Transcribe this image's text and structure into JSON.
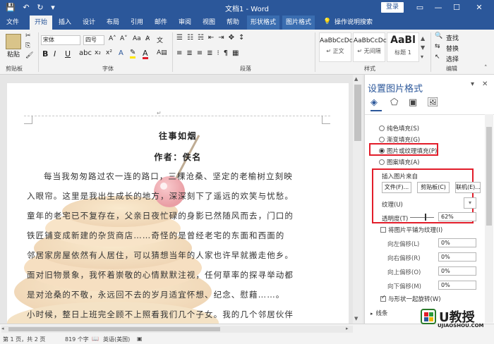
{
  "titlebar": {
    "title": "文档1 - Word",
    "login": "登录",
    "qa_save": "💾",
    "qa_undo": "↶",
    "qa_redo": "↻",
    "qa_more": "▾",
    "restore": "▭",
    "minimize": "—",
    "maximize": "☐",
    "close": "✕"
  },
  "tabs": [
    "文件",
    "开始",
    "插入",
    "设计",
    "布局",
    "引用",
    "邮件",
    "审阅",
    "视图",
    "帮助",
    "形状格式",
    "图片格式",
    "操作说明搜索"
  ],
  "ribbon": {
    "paste": "粘贴",
    "clipboard": "剪贴板",
    "font_name": "宋体",
    "font_size": "四号",
    "font_group": "字体",
    "para_group": "段落",
    "styles_group": "样式",
    "edit_group": "编辑",
    "bold": "B",
    "italic": "I",
    "underline": "U",
    "font_color": "A",
    "styles": [
      {
        "sample": "AaBbCcDc",
        "name": "↵ 正文"
      },
      {
        "sample": "AaBbCcDc",
        "name": "↵ 无间隔"
      },
      {
        "sample": "AaBl",
        "name": "标题 1"
      }
    ],
    "find": "查找",
    "replace": "替换",
    "select": "选择"
  },
  "document": {
    "title": "往事如烟",
    "author": "作者：佚名",
    "paragraphs": [
      "每当我匆匆路过农一连的路口，三棵沧桑、坚定的老榆树立刻映",
      "入眼帘。这里是我出生成长的地方，深深刻下了遥远的欢笑与忧愁。",
      "童年的老宅已不复存在，父亲日夜忙碌的身影已然随风而去，门口的",
      "铁匠铺变成新建的杂货商店……奇怪的是曾经老宅的东面和西面的",
      "邻居家房屋依然有人居住，可以猜想当年的人家也许早就搬走他乡。",
      "面对旧物景象，我怀着崇敬的心情默默注视，任何草率的探寻举动都",
      "是对沧桑的不敬，永远回不去的岁月适宜怀想、纪念、慰藉……。",
      "小时候，整日上班完全顾不上照看我们几个子女。我的几个邻居伙伴"
    ]
  },
  "pane": {
    "title": "设置图片格式",
    "fill_options": [
      {
        "label": "纯色填充(S)",
        "on": false
      },
      {
        "label": "渐变填充(G)",
        "on": false
      },
      {
        "label": "图片或纹理填充(P)",
        "on": true
      },
      {
        "label": "图案填充(A)",
        "on": false
      }
    ],
    "insert_from": "插入图片来自",
    "file_btn": "文件(F)...",
    "clipboard_btn": "剪贴板(C)",
    "online_btn": "联机(E)...",
    "texture": "纹理(U)",
    "transparency": "透明度(T)",
    "transparency_value": "62%",
    "transparency_level": 0.62,
    "tile_label": "将图片平铺为纹理(I)",
    "offsets": [
      {
        "label": "向左偏移(L)",
        "value": "0%"
      },
      {
        "label": "向右偏移(R)",
        "value": "0%"
      },
      {
        "label": "向上偏移(O)",
        "value": "0%"
      },
      {
        "label": "向下偏移(M)",
        "value": "0%"
      }
    ],
    "rotate_label": "与形状一起旋转(W)",
    "line_section": "线条"
  },
  "status": {
    "page": "第 1 页，共 2 页",
    "words": "819 个字",
    "lang": "英语(美国)"
  },
  "watermark": {
    "brand": "U教授",
    "url": "UJIAOSHOU.COM"
  },
  "colors": {
    "brand_blue": "#2b579a",
    "highlight_red": "#e21d2a"
  }
}
